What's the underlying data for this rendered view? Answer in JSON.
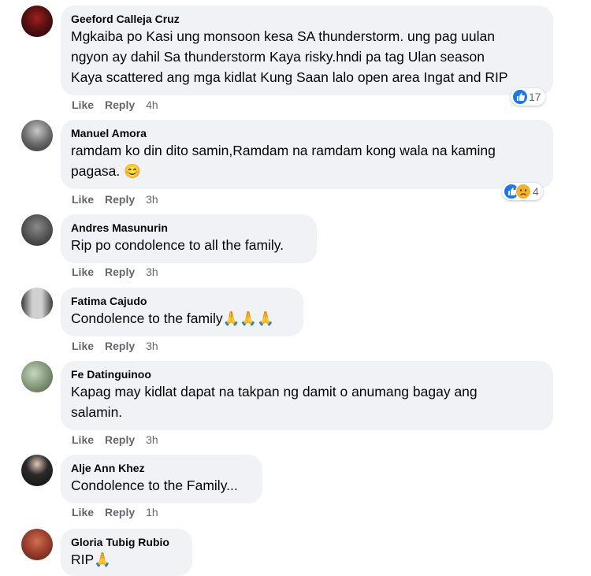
{
  "actions": {
    "like": "Like",
    "reply": "Reply"
  },
  "comments": [
    {
      "author": "Geeford Calleja Cruz",
      "text": "Mgkaiba po Kasi ung monsoon kesa SA thunderstorm. ung pag uulan\nngyon ay dahil Sa thunderstorm Kaya risky.hndi pa tag Ulan season\nKaya scattered ang mga kidlat Kung Saan lalo open area Ingat and RIP",
      "time": "4h",
      "reactions": "17"
    },
    {
      "author": "Manuel Amora",
      "text": "ramdam ko din dito samin,Ramdam na ramdam kong wala na kaming\npagasa. 😊",
      "time": "3h",
      "reactions": "4"
    },
    {
      "author": "Andres Masunurin",
      "text": "Rip po condolence to all the family.",
      "time": "3h"
    },
    {
      "author": "Fatima Cajudo",
      "text": "Condolence to the family🙏🙏🙏",
      "time": "3h"
    },
    {
      "author": "Fe Datinguinoo",
      "text": "Kapag may kidlat dapat na takpan ng damit o anumang bagay ang\nsalamin.",
      "time": "3h"
    },
    {
      "author": "Alje Ann Khez",
      "text": "Condolence to the Family...",
      "time": "1h"
    },
    {
      "author": "Gloria Tubig Rubio",
      "text": "RIP🙏"
    }
  ]
}
